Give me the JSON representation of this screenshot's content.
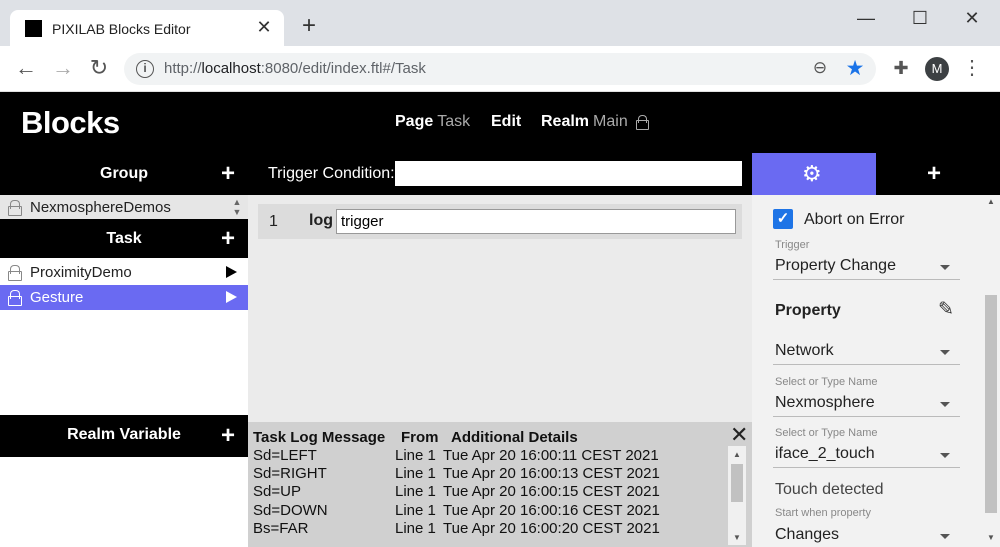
{
  "browser": {
    "tab_title": "PIXILAB Blocks Editor",
    "url_prefix": "http://",
    "url_host": "localhost",
    "url_rest": ":8080/edit/index.ftl#/Task",
    "avatar_letter": "M"
  },
  "header": {
    "logo": "Blocks",
    "nav": [
      {
        "label": "Page",
        "sub": "Task"
      },
      {
        "label": "Edit",
        "sub": ""
      },
      {
        "label": "Realm",
        "sub": "Main"
      }
    ]
  },
  "left": {
    "group_title": "Group",
    "group_item": "NexmosphereDemos",
    "task_title": "Task",
    "tasks": [
      {
        "label": "ProximityDemo",
        "selected": false
      },
      {
        "label": "Gesture",
        "selected": true
      }
    ],
    "realm_variable_title": "Realm Variable"
  },
  "trigger": {
    "label": "Trigger Condition:",
    "value": ""
  },
  "code": {
    "line_number": "1",
    "keyword": "log",
    "value": "trigger"
  },
  "task_log": {
    "columns": [
      "Task Log Message",
      "From",
      "Additional Details"
    ],
    "rows": [
      {
        "message": "Sd=LEFT",
        "from": "Line 1",
        "details": "Tue Apr 20 16:00:11 CEST 2021"
      },
      {
        "message": "Sd=RIGHT",
        "from": "Line 1",
        "details": "Tue Apr 20 16:00:13 CEST 2021"
      },
      {
        "message": "Sd=UP",
        "from": "Line 1",
        "details": "Tue Apr 20 16:00:15 CEST 2021"
      },
      {
        "message": "Sd=DOWN",
        "from": "Line 1",
        "details": "Tue Apr 20 16:00:16 CEST 2021"
      },
      {
        "message": "Bs=FAR",
        "from": "Line 1",
        "details": "Tue Apr 20 16:00:20 CEST 2021"
      }
    ]
  },
  "settings": {
    "abort_on_error": "Abort on Error",
    "trigger_caption": "Trigger",
    "trigger_value": "Property Change",
    "property_label": "Property",
    "property_type": "Network",
    "name_caption_1": "Select or Type Name",
    "name_value_1": "Nexmosphere",
    "name_caption_2": "Select or Type Name",
    "name_value_2": "iface_2_touch",
    "touch_text": "Touch detected",
    "start_caption": "Start when property",
    "start_value": "Changes"
  },
  "colors": {
    "accent": "#6a6af2",
    "checkbox": "#1e74e6",
    "header_bg": "#000000"
  }
}
